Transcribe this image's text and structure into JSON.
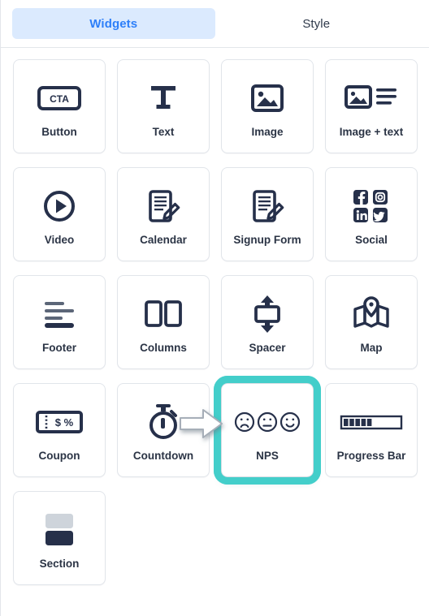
{
  "tabs": [
    {
      "label": "Widgets",
      "active": true,
      "name": "tab-widgets"
    },
    {
      "label": "Style",
      "active": false,
      "name": "tab-style"
    }
  ],
  "colors": {
    "accent_tab_text": "#2d7ff9",
    "accent_tab_bg": "#dbeafe",
    "icon_ink": "#26304a",
    "label_text": "#2b3445",
    "highlight_teal": "#43ceca",
    "card_border": "#e1e5ea",
    "section_light": "#ced4db",
    "section_dark": "#26304a"
  },
  "widgets": [
    {
      "label": "Button",
      "icon": "cta-button-icon",
      "icon_text": "CTA",
      "highlighted": false
    },
    {
      "label": "Text",
      "icon": "text-t-icon",
      "icon_text": "",
      "highlighted": false
    },
    {
      "label": "Image",
      "icon": "image-icon",
      "icon_text": "",
      "highlighted": false
    },
    {
      "label": "Image + text",
      "icon": "image-text-icon",
      "icon_text": "",
      "highlighted": false
    },
    {
      "label": "Video",
      "icon": "play-circle-icon",
      "icon_text": "",
      "highlighted": false
    },
    {
      "label": "Calendar",
      "icon": "document-pencil-icon",
      "icon_text": "",
      "highlighted": false
    },
    {
      "label": "Signup Form",
      "icon": "document-pencil-icon",
      "icon_text": "",
      "highlighted": false
    },
    {
      "label": "Social",
      "icon": "social-icons",
      "icon_text": "",
      "highlighted": false
    },
    {
      "label": "Footer",
      "icon": "footer-lines-icon",
      "icon_text": "",
      "highlighted": false
    },
    {
      "label": "Columns",
      "icon": "columns-icon",
      "icon_text": "",
      "highlighted": false
    },
    {
      "label": "Spacer",
      "icon": "spacer-arrows-icon",
      "icon_text": "",
      "highlighted": false
    },
    {
      "label": "Map",
      "icon": "map-pin-icon",
      "icon_text": "",
      "highlighted": false
    },
    {
      "label": "Coupon",
      "icon": "coupon-icon",
      "icon_text": "$ %",
      "highlighted": false
    },
    {
      "label": "Countdown",
      "icon": "stopwatch-icon",
      "icon_text": "",
      "highlighted": false
    },
    {
      "label": "NPS",
      "icon": "nps-faces-icon",
      "icon_text": "",
      "highlighted": true
    },
    {
      "label": "Progress Bar",
      "icon": "progress-bar-icon",
      "icon_text": "",
      "highlighted": false
    },
    {
      "label": "Section",
      "icon": "section-blocks-icon",
      "icon_text": "",
      "highlighted": false
    }
  ],
  "social_networks": [
    "facebook",
    "instagram",
    "linkedin",
    "twitter"
  ],
  "progress_bar": {
    "filled_blocks": 5,
    "total_blocks": 10
  },
  "cursor": {
    "name": "pointer-arrow-cursor",
    "direction": "right"
  }
}
